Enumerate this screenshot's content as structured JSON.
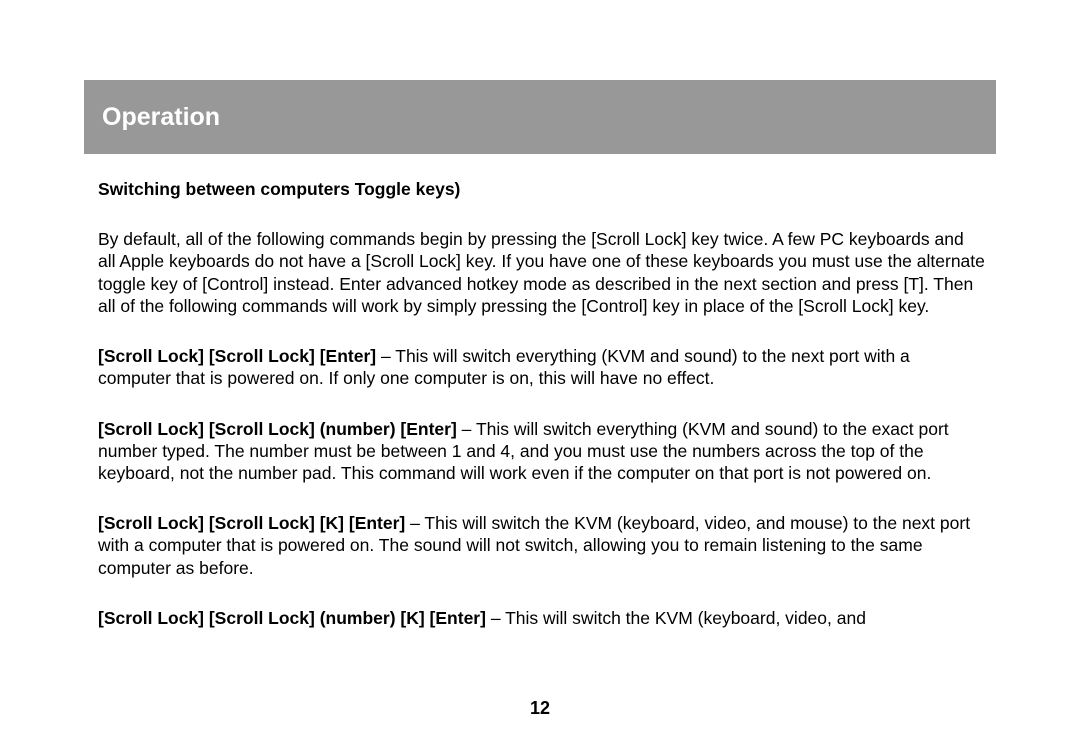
{
  "header": {
    "title": "Operation"
  },
  "subheading": "Switching between computers Toggle keys)",
  "intro": "By default, all of the following commands begin by pressing the [Scroll Lock] key twice.  A few PC keyboards and all Apple keyboards do not have a [Scroll Lock] key.  If you have one of these keyboards you must use the alternate toggle key of [Control] instead.  Enter advanced hotkey mode as described in the next section and press [T].  Then all of the following commands will work by simply pressing the [Control] key in place of the [Scroll Lock] key.",
  "cmds": [
    {
      "label": "[Scroll Lock] [Scroll Lock] [Enter]",
      "desc": " – This will switch everything (KVM and sound) to the next port with a computer that is powered on.  If only one computer is on, this will have no effect."
    },
    {
      "label": "[Scroll Lock] [Scroll Lock] (number) [Enter]",
      "desc": " – This will switch everything (KVM and sound) to the exact port number typed.  The number must be between 1 and 4, and you must use the numbers across the top of the keyboard, not the number pad.  This command will work even if the computer on that port is not powered on."
    },
    {
      "label": "[Scroll Lock] [Scroll Lock] [K] [Enter]",
      "desc": " – This will switch the KVM (keyboard, video, and mouse) to the next port with a computer that is powered on.  The sound will not switch, allowing you to remain listening to the same computer as before."
    },
    {
      "label": "[Scroll Lock] [Scroll Lock] (number) [K] [Enter]",
      "desc": " – This will switch the KVM (keyboard, video, and"
    }
  ],
  "page_number": "12"
}
